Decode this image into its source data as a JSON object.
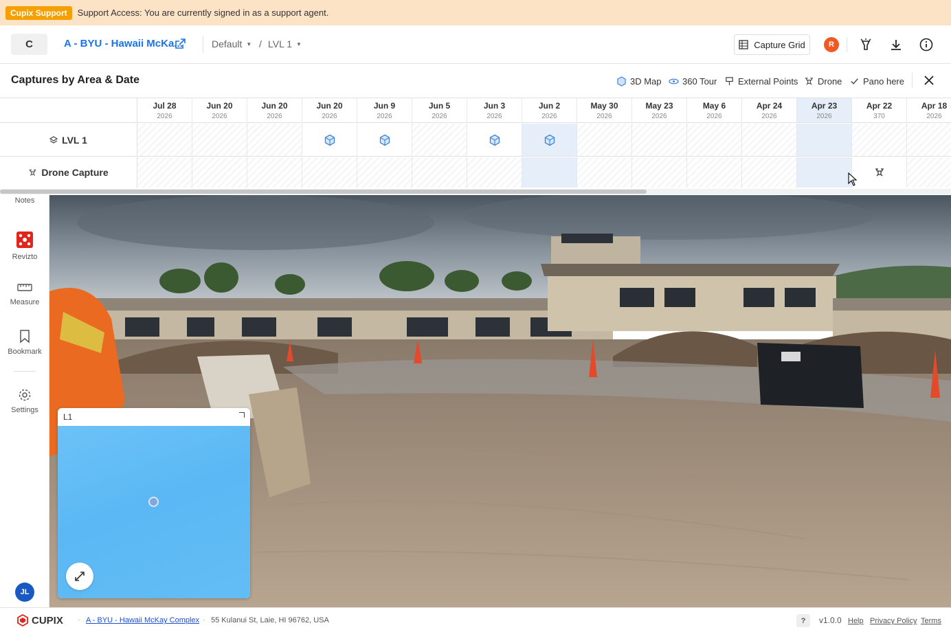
{
  "banner": {
    "tag": "Cupix Support",
    "message": "Support Access: You are currently signed in as a support agent."
  },
  "header": {
    "logo_letter": "C",
    "project_name": "A - BYU - Hawaii McKa...",
    "breadcrumb": [
      {
        "label": "Default"
      },
      {
        "label": "LVL 1"
      }
    ],
    "breadcrumb_sep": "/",
    "capture_grid_label": "Capture Grid",
    "orange_badge": "R"
  },
  "captures": {
    "title": "Captures by Area & Date",
    "tools": {
      "map3d": "3D Map",
      "tour360": "360 Tour",
      "external": "External Points",
      "drone": "Drone",
      "pano_here": "Pano here"
    },
    "columns": [
      {
        "date": "Jul 28",
        "year": "2026"
      },
      {
        "date": "Jun 20",
        "year": "2026"
      },
      {
        "date": "Jun 20",
        "year": "2026"
      },
      {
        "date": "Jun 20",
        "year": "2026"
      },
      {
        "date": "Jun 9",
        "year": "2026"
      },
      {
        "date": "Jun 5",
        "year": "2026"
      },
      {
        "date": "Jun 3",
        "year": "2026"
      },
      {
        "date": "Jun 2",
        "year": "2026"
      },
      {
        "date": "May 30",
        "year": "2026"
      },
      {
        "date": "May 23",
        "year": "2026"
      },
      {
        "date": "May 6",
        "year": "2026"
      },
      {
        "date": "Apr 24",
        "year": "2026"
      },
      {
        "date": "Apr 23",
        "year": "2026"
      },
      {
        "date": "Apr 22",
        "year": "370"
      },
      {
        "date": "Apr 18",
        "year": "2026"
      }
    ],
    "rows": [
      {
        "label": "LVL 1",
        "icon": "layers-icon",
        "capture_columns": [
          3,
          4,
          6,
          7
        ]
      },
      {
        "label": "Drone Capture",
        "icon": "drone-icon",
        "capture_columns": [
          13
        ]
      }
    ],
    "selected_column_row1": 7,
    "selected_column_row2_a": 7,
    "selected_column_header": 12,
    "scroll_fraction": 0.68
  },
  "sidebar": {
    "items": [
      {
        "label": "Notes",
        "icon": "note-icon"
      },
      {
        "label": "Revizto",
        "icon": "revizto-icon"
      },
      {
        "label": "Measure",
        "icon": "ruler-icon"
      },
      {
        "label": "Bookmark",
        "icon": "bookmark-icon"
      },
      {
        "label": "Settings",
        "icon": "gear-icon"
      }
    ],
    "avatar": "JL"
  },
  "minimap": {
    "title": "L1"
  },
  "footer": {
    "brand": "CUPIX",
    "project_link": "A - BYU - Hawaii McKay Complex",
    "address": "55 Kulanui St, Laie, HI 96762, USA",
    "help_icon": "?",
    "version": "v1.0.0",
    "links": [
      "Help",
      "Privacy Policy",
      "Terms"
    ]
  },
  "colors": {
    "accent": "#1a73e8",
    "banner_bg": "#fde3c6",
    "banner_tag": "#f5a000",
    "selected_cell": "#e5eef9",
    "avatar": "#1859c4",
    "map_blue": "#5bb8f4"
  }
}
